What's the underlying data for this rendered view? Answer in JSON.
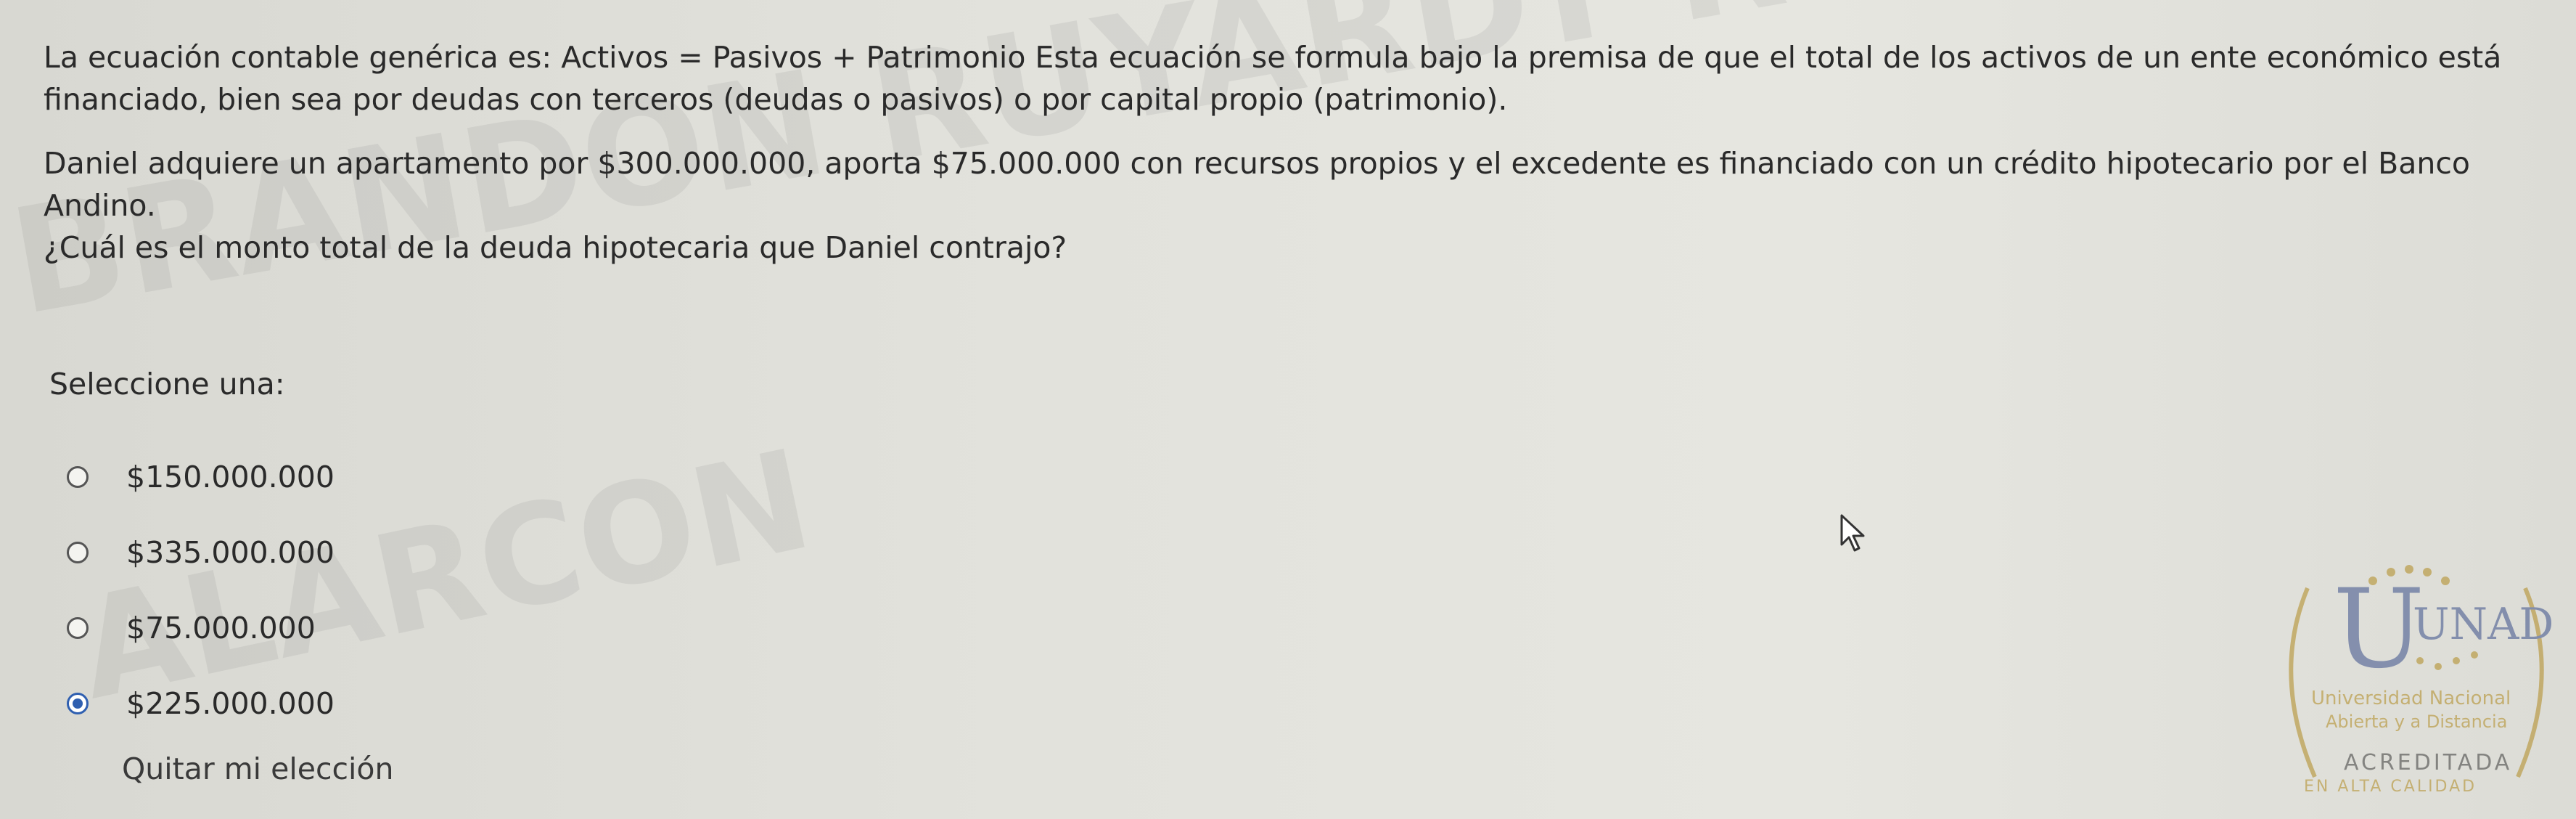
{
  "question": {
    "paragraph1": "La ecuación contable genérica es: Activos = Pasivos + Patrimonio Esta ecuación se formula bajo la premisa de que el total de los activos de un ente económico está financiado, bien sea por deudas con terceros (deudas o pasivos) o por capital propio (patrimonio).",
    "paragraph2": "Daniel adquiere un apartamento por $300.000.000, aporta $75.000.000 con recursos propios y el excedente es financiado con un crédito hipotecario por el Banco Andino.",
    "paragraph3": "¿Cuál es el monto total de la deuda hipotecaria que Daniel contrajo?"
  },
  "prompt": "Seleccione una:",
  "options": [
    {
      "label": "$150.000.000",
      "selected": false
    },
    {
      "label": "$335.000.000",
      "selected": false
    },
    {
      "label": "$75.000.000",
      "selected": false
    },
    {
      "label": "$225.000.000",
      "selected": true
    }
  ],
  "clear_label": "Quitar mi elección",
  "watermark": {
    "line1": "BRANDON RUYARDY ROMERO",
    "line2": "ALARCON"
  },
  "logo": {
    "name": "UNAD",
    "line1": "Universidad Nacional",
    "line2": "Abierta y a Distancia",
    "badge": "ACREDITADA",
    "badge_sub": "EN ALTA CALIDAD"
  },
  "colors": {
    "accent": "#2f5fb0",
    "text": "#2a2a2a",
    "logo_gold": "#b08a20",
    "logo_blue": "#3a4f8a"
  }
}
